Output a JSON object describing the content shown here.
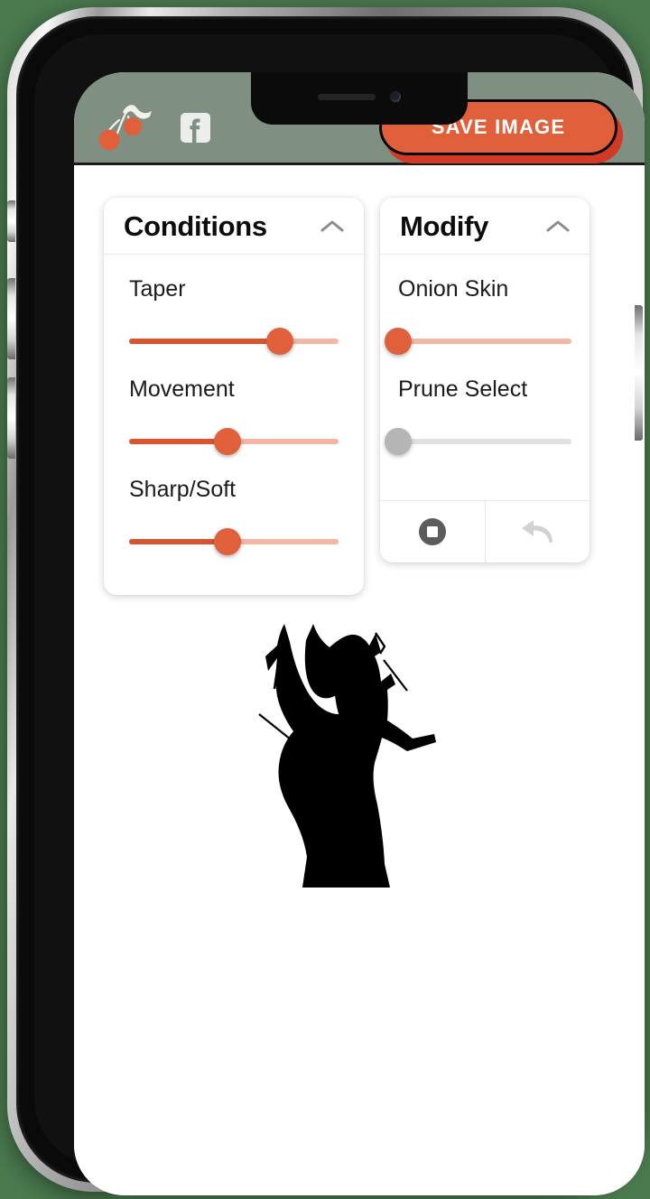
{
  "device": {
    "type": "smartphone-mockup",
    "notch": {
      "speaker": "earpiece-speaker",
      "camera": "front-camera"
    },
    "buttons": [
      "silent-switch",
      "volume-up",
      "volume-down",
      "power"
    ]
  },
  "colors": {
    "page_background": "#4a7a4e",
    "header_background": "#7f9082",
    "accent_orange": "#e0603c",
    "accent_orange_dark": "#d9552f",
    "accent_orange_shadow": "#d13a25",
    "track_inactive": "#f1b6a4",
    "track_disabled": "#e0e0e0",
    "thumb_disabled": "#b5b5b5",
    "panel_background": "#ffffff",
    "text_primary": "#0d0d0d",
    "tree_silhouette": "#000000"
  },
  "header": {
    "logo_name": "cherry-branch-logo",
    "facebook_label": "f",
    "save_button_label": "SAVE IMAGE"
  },
  "panels": [
    {
      "id": "conditions",
      "title": "Conditions",
      "collapse_icon": "chevron-up-icon",
      "expanded": true,
      "sliders": [
        {
          "id": "taper",
          "label": "Taper",
          "value": 72,
          "min": 0,
          "max": 100,
          "enabled": true
        },
        {
          "id": "movement",
          "label": "Movement",
          "value": 47,
          "min": 0,
          "max": 100,
          "enabled": true
        },
        {
          "id": "sharp-soft",
          "label": "Sharp/Soft",
          "value": 47,
          "min": 0,
          "max": 100,
          "enabled": true
        }
      ]
    },
    {
      "id": "modify",
      "title": "Modify",
      "collapse_icon": "chevron-up-icon",
      "expanded": true,
      "sliders": [
        {
          "id": "onion-skin",
          "label": "Onion Skin",
          "value": 0,
          "min": 0,
          "max": 100,
          "enabled": true
        },
        {
          "id": "prune-select",
          "label": "Prune Select",
          "value": 0,
          "min": 0,
          "max": 100,
          "enabled": false
        }
      ],
      "actions": [
        {
          "id": "stop",
          "icon": "stop-button-icon",
          "enabled": true
        },
        {
          "id": "undo",
          "icon": "undo-arrow-icon",
          "enabled": false
        }
      ]
    }
  ],
  "canvas": {
    "artwork_name": "bonsai-tree-silhouette",
    "description": "Black silhouette of a windswept bonsai tree with a thick trunk and bare branches"
  }
}
